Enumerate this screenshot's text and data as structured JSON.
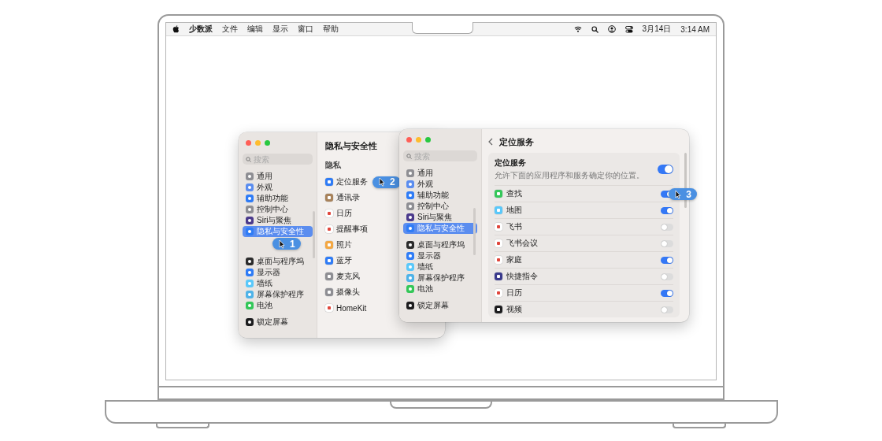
{
  "menu_bar": {
    "app_name": "少数派",
    "menus": [
      "文件",
      "编辑",
      "显示",
      "窗口",
      "帮助"
    ],
    "date": "3月14日",
    "time": "3:14 AM"
  },
  "windows": [
    {
      "sidebar": {
        "search_placeholder": "搜索",
        "groups": [
          [
            {
              "label": "通用",
              "selected": false
            },
            {
              "label": "外观",
              "selected": false
            },
            {
              "label": "辅助功能",
              "selected": false
            },
            {
              "label": "控制中心",
              "selected": false
            },
            {
              "label": "Siri与聚焦",
              "selected": false
            },
            {
              "label": "隐私与安全性",
              "selected": true,
              "callout": "1"
            }
          ],
          [
            {
              "label": "桌面与程序坞",
              "selected": false
            },
            {
              "label": "显示器",
              "selected": false
            },
            {
              "label": "墙纸",
              "selected": false
            },
            {
              "label": "屏幕保护程序",
              "selected": false
            },
            {
              "label": "电池",
              "selected": false
            }
          ],
          [
            {
              "label": "锁定屏幕",
              "selected": false
            }
          ]
        ]
      },
      "content": {
        "title": "隐私与安全性",
        "section": "隐私",
        "items": [
          {
            "label": "定位服务",
            "callout": "2"
          },
          {
            "label": "通讯录"
          },
          {
            "label": "日历"
          },
          {
            "label": "提醒事项"
          },
          {
            "label": "照片"
          },
          {
            "label": "蓝牙"
          },
          {
            "label": "麦克风"
          },
          {
            "label": "摄像头"
          },
          {
            "label": "HomeKit"
          }
        ]
      }
    },
    {
      "sidebar": {
        "search_placeholder": "搜索",
        "groups": [
          [
            {
              "label": "通用",
              "selected": false
            },
            {
              "label": "外观",
              "selected": false
            },
            {
              "label": "辅助功能",
              "selected": false
            },
            {
              "label": "控制中心",
              "selected": false
            },
            {
              "label": "Siri与聚焦",
              "selected": false
            },
            {
              "label": "隐私与安全性",
              "selected": true
            }
          ],
          [
            {
              "label": "桌面与程序坞",
              "selected": false
            },
            {
              "label": "显示器",
              "selected": false
            },
            {
              "label": "墙纸",
              "selected": false
            },
            {
              "label": "屏幕保护程序",
              "selected": false
            },
            {
              "label": "电池",
              "selected": false
            }
          ],
          [
            {
              "label": "锁定屏幕",
              "selected": false
            }
          ]
        ]
      },
      "detail": {
        "title": "定位服务",
        "master": {
          "label": "定位服务",
          "description": "允许下面的应用程序和服务确定你的位置。",
          "on": true
        },
        "apps": [
          {
            "label": "查找",
            "on": true,
            "callout": "3"
          },
          {
            "label": "地图",
            "on": true
          },
          {
            "label": "飞书",
            "on": false
          },
          {
            "label": "飞书会议",
            "on": false
          },
          {
            "label": "家庭",
            "on": true
          },
          {
            "label": "快捷指令",
            "on": false
          },
          {
            "label": "日历",
            "on": true
          },
          {
            "label": "视频",
            "on": false
          }
        ]
      }
    }
  ]
}
